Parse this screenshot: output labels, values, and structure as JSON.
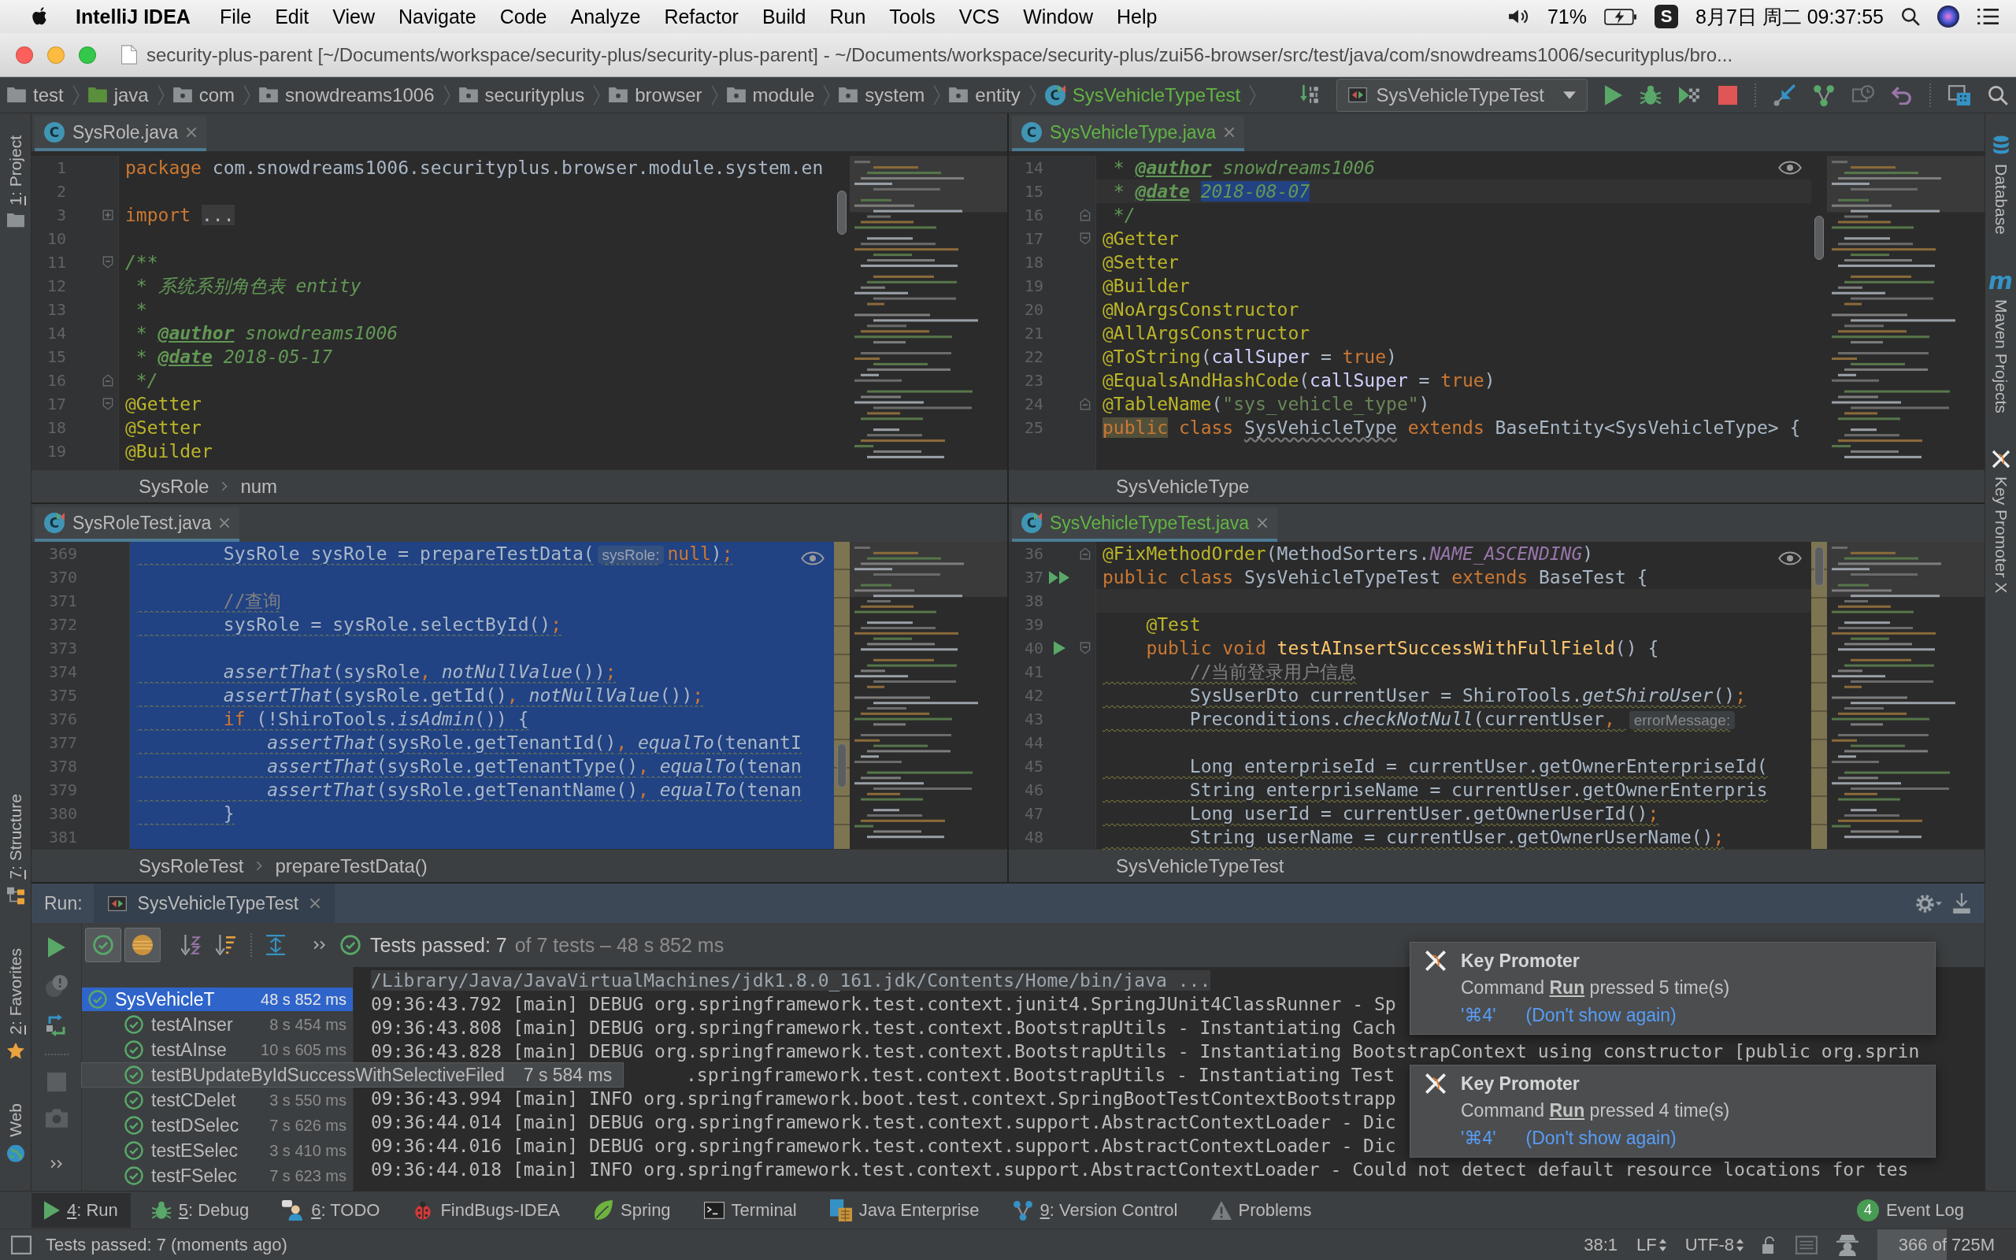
{
  "menubar": {
    "app": "IntelliJ IDEA",
    "menus": [
      "File",
      "Edit",
      "View",
      "Navigate",
      "Code",
      "Analyze",
      "Refactor",
      "Build",
      "Run",
      "Tools",
      "VCS",
      "Window",
      "Help"
    ],
    "battery": "71%",
    "input_method": "S",
    "clock": "8月7日 周二 09:37:55"
  },
  "window": {
    "title": "security-plus-parent [~/Documents/workspace/security-plus/security-plus-parent] - ~/Documents/workspace/security-plus/zui56-browser/src/test/java/com/snowdreams1006/securityplus/bro..."
  },
  "navbar": {
    "crumbs": [
      {
        "label": "test",
        "kind": "folder",
        "new_file": false
      },
      {
        "label": "java",
        "kind": "source-folder",
        "new_file": false
      },
      {
        "label": "com",
        "kind": "package",
        "new_file": false
      },
      {
        "label": "snowdreams1006",
        "kind": "package",
        "new_file": false
      },
      {
        "label": "securityplus",
        "kind": "package",
        "new_file": false
      },
      {
        "label": "browser",
        "kind": "package",
        "new_file": false
      },
      {
        "label": "module",
        "kind": "package",
        "new_file": false
      },
      {
        "label": "system",
        "kind": "package",
        "new_file": false
      },
      {
        "label": "entity",
        "kind": "package",
        "new_file": false
      },
      {
        "label": "SysVehicleTypeTest",
        "kind": "test-class",
        "glyph": "C",
        "new_file": true
      }
    ],
    "run_config": "SysVehicleTypeTest"
  },
  "left_strip": {
    "top": [
      {
        "mnemonic": "1",
        "label": ": Project",
        "kind": "project"
      }
    ],
    "bottom": [
      {
        "mnemonic": "7",
        "label": ": Structure",
        "kind": "structure"
      },
      {
        "mnemonic": "2",
        "label": ": Favorites",
        "kind": "favorites"
      },
      {
        "label": "Web",
        "kind": "web"
      }
    ]
  },
  "right_strip": [
    {
      "label": "Database",
      "kind": "database"
    },
    {
      "label": "Maven Projects",
      "kind": "maven",
      "glyph": "m"
    },
    {
      "label": "Key Promoter X",
      "kind": "promoter"
    }
  ],
  "editors": [
    {
      "tab": {
        "label": "SysRole.java",
        "glyph": "C",
        "kind": "class",
        "new_file": false,
        "selected": true
      },
      "reader_mode": false,
      "lines": [
        {
          "number": "1",
          "tokens": [
            {
              "kind": "keyword",
              "text": "package"
            },
            {
              "kind": "plain",
              "text": " com.snowdreams1006.securityplus.browser.module.system.en"
            }
          ]
        },
        {
          "number": "2"
        },
        {
          "number": "3",
          "collapsed": true,
          "tokens": [
            {
              "kind": "keyword",
              "text": "import"
            },
            {
              "kind": "folded",
              "text": " ..."
            }
          ]
        },
        {
          "number": "10"
        },
        {
          "number": "11",
          "fold_start": true,
          "tokens": [
            {
              "kind": "doc",
              "text": "/**"
            }
          ]
        },
        {
          "number": "12",
          "tokens": [
            {
              "kind": "doc",
              "text": " * 系统系别角色表 entity"
            }
          ]
        },
        {
          "number": "13",
          "tokens": [
            {
              "kind": "doc",
              "text": " *"
            }
          ]
        },
        {
          "number": "14",
          "tokens": [
            {
              "kind": "doc",
              "text": " * "
            },
            {
              "kind": "doctag",
              "text": "@author"
            },
            {
              "kind": "doc",
              "text": " snowdreams1006"
            }
          ]
        },
        {
          "number": "15",
          "tokens": [
            {
              "kind": "doc",
              "text": " * "
            },
            {
              "kind": "doctag",
              "text": "@date"
            },
            {
              "kind": "doc",
              "text": " 2018-05-17"
            }
          ]
        },
        {
          "number": "16",
          "fold_end": true,
          "tokens": [
            {
              "kind": "doc",
              "text": " */"
            }
          ]
        },
        {
          "number": "17",
          "fold_start": true,
          "tokens": [
            {
              "kind": "annotation",
              "text": "@Getter"
            }
          ]
        },
        {
          "number": "18",
          "tokens": [
            {
              "kind": "annotation",
              "text": "@Setter"
            }
          ]
        },
        {
          "number": "19",
          "tokens": [
            {
              "kind": "annotation",
              "text": "@Builder"
            }
          ]
        }
      ],
      "footer": [
        "SysRole",
        "num"
      ]
    },
    {
      "tab": {
        "label": "SysVehicleType.java",
        "glyph": "C",
        "kind": "class",
        "new_file": true,
        "selected": true
      },
      "reader_mode": true,
      "lines": [
        {
          "number": "14",
          "tokens": [
            {
              "kind": "doc",
              "text": " * "
            },
            {
              "kind": "doctag",
              "text": "@author"
            },
            {
              "kind": "doc",
              "text": " snowdreams1006"
            }
          ]
        },
        {
          "number": "15",
          "current": true,
          "tokens": [
            {
              "kind": "doc",
              "text": " * "
            },
            {
              "kind": "doctag",
              "text": "@date"
            },
            {
              "kind": "selected",
              "text": " 2018-08-07"
            }
          ]
        },
        {
          "number": "16",
          "fold_end": true,
          "tokens": [
            {
              "kind": "doc",
              "text": " */"
            }
          ]
        },
        {
          "number": "17",
          "fold_start": true,
          "tokens": [
            {
              "kind": "annotation",
              "text": "@Getter"
            }
          ]
        },
        {
          "number": "18",
          "tokens": [
            {
              "kind": "annotation",
              "text": "@Setter"
            }
          ]
        },
        {
          "number": "19",
          "tokens": [
            {
              "kind": "annotation",
              "text": "@Builder"
            }
          ]
        },
        {
          "number": "20",
          "tokens": [
            {
              "kind": "annotation",
              "text": "@NoArgsConstructor"
            }
          ]
        },
        {
          "number": "21",
          "tokens": [
            {
              "kind": "annotation",
              "text": "@AllArgsConstructor"
            }
          ]
        },
        {
          "number": "22",
          "tokens": [
            {
              "kind": "annotation",
              "text": "@ToString"
            },
            {
              "kind": "plain",
              "text": "("
            },
            {
              "kind": "param",
              "text": "callSuper"
            },
            {
              "kind": "plain",
              "text": " = "
            },
            {
              "kind": "keyword",
              "text": "true"
            },
            {
              "kind": "plain",
              "text": ")"
            }
          ]
        },
        {
          "number": "23",
          "tokens": [
            {
              "kind": "annotation",
              "text": "@EqualsAndHashCode"
            },
            {
              "kind": "plain",
              "text": "("
            },
            {
              "kind": "param",
              "text": "callSuper"
            },
            {
              "kind": "plain",
              "text": " = "
            },
            {
              "kind": "keyword",
              "text": "true"
            },
            {
              "kind": "plain",
              "text": ")"
            }
          ]
        },
        {
          "number": "24",
          "fold_end": true,
          "tokens": [
            {
              "kind": "annotation",
              "text": "@TableName"
            },
            {
              "kind": "plain",
              "text": "("
            },
            {
              "kind": "string",
              "text": "\"sys_vehicle_type\""
            },
            {
              "kind": "plain",
              "text": ")"
            }
          ]
        },
        {
          "number": "25",
          "tokens": [
            {
              "kind": "usage",
              "text": "public"
            },
            {
              "kind": "keyword",
              "text": " class"
            },
            {
              "kind": "warn",
              "text": " SysVehicleType"
            },
            {
              "kind": "keyword",
              "text": " extends"
            },
            {
              "kind": "plain",
              "text": " BaseEntity<SysVehicleType> {"
            }
          ]
        }
      ],
      "footer": [
        "SysVehicleType"
      ]
    },
    {
      "tab": {
        "label": "SysRoleTest.java",
        "glyph": "C",
        "kind": "test-class",
        "new_file": false,
        "selected": true
      },
      "reader_mode": true,
      "lines": [
        {
          "number": "369",
          "selected": true,
          "warning": true,
          "tokens": [
            {
              "kind": "plain",
              "text": "        SysRole sysRole = prepareTestData("
            },
            {
              "kind": "hint",
              "text": "sysRole:"
            },
            {
              "kind": "keyword",
              "text": "null"
            },
            {
              "kind": "plain",
              "text": ")"
            },
            {
              "kind": "keyword",
              "text": ";"
            }
          ]
        },
        {
          "number": "370",
          "selected": true
        },
        {
          "number": "371",
          "selected": true,
          "warning": true,
          "tokens": [
            {
              "kind": "comment",
              "text": "        //查询"
            }
          ]
        },
        {
          "number": "372",
          "selected": true,
          "warning": true,
          "tokens": [
            {
              "kind": "plain",
              "text": "        sysRole = sysRole.selectById()"
            },
            {
              "kind": "keyword",
              "text": ";"
            }
          ]
        },
        {
          "number": "373",
          "selected": true
        },
        {
          "number": "374",
          "selected": true,
          "warning": true,
          "tokens": [
            {
              "kind": "static",
              "text": "        assertThat"
            },
            {
              "kind": "plain",
              "text": "(sysRole"
            },
            {
              "kind": "keyword",
              "text": ","
            },
            {
              "kind": "static",
              "text": " notNullValue"
            },
            {
              "kind": "plain",
              "text": "())"
            },
            {
              "kind": "keyword",
              "text": ";"
            }
          ]
        },
        {
          "number": "375",
          "selected": true,
          "warning": true,
          "tokens": [
            {
              "kind": "static",
              "text": "        assertThat"
            },
            {
              "kind": "plain",
              "text": "(sysRole.getId()"
            },
            {
              "kind": "keyword",
              "text": ","
            },
            {
              "kind": "static",
              "text": " notNullValue"
            },
            {
              "kind": "plain",
              "text": "())"
            },
            {
              "kind": "keyword",
              "text": ";"
            }
          ]
        },
        {
          "number": "376",
          "selected": true,
          "warning": true,
          "tokens": [
            {
              "kind": "keyword",
              "text": "        if"
            },
            {
              "kind": "plain",
              "text": " (!ShiroTools."
            },
            {
              "kind": "static",
              "text": "isAdmin"
            },
            {
              "kind": "plain",
              "text": "()) {"
            }
          ]
        },
        {
          "number": "377",
          "selected": true,
          "warning": true,
          "tokens": [
            {
              "kind": "static",
              "text": "            assertThat"
            },
            {
              "kind": "plain",
              "text": "(sysRole.getTenantId()"
            },
            {
              "kind": "keyword",
              "text": ","
            },
            {
              "kind": "static",
              "text": " equalTo"
            },
            {
              "kind": "plain",
              "text": "(tenantI"
            }
          ]
        },
        {
          "number": "378",
          "selected": true,
          "warning": true,
          "tokens": [
            {
              "kind": "static",
              "text": "            assertThat"
            },
            {
              "kind": "plain",
              "text": "(sysRole.getTenantType()"
            },
            {
              "kind": "keyword",
              "text": ","
            },
            {
              "kind": "static",
              "text": " equalTo"
            },
            {
              "kind": "plain",
              "text": "(tenan"
            }
          ]
        },
        {
          "number": "379",
          "selected": true,
          "warning": true,
          "tokens": [
            {
              "kind": "static",
              "text": "            assertThat"
            },
            {
              "kind": "plain",
              "text": "(sysRole.getTenantName()"
            },
            {
              "kind": "keyword",
              "text": ","
            },
            {
              "kind": "static",
              "text": " equalTo"
            },
            {
              "kind": "plain",
              "text": "(tenan"
            }
          ]
        },
        {
          "number": "380",
          "selected": true,
          "warning": true,
          "tokens": [
            {
              "kind": "plain",
              "text": "        }"
            }
          ]
        },
        {
          "number": "381",
          "selected": true
        }
      ],
      "footer": [
        "SysRoleTest",
        "prepareTestData()"
      ]
    },
    {
      "tab": {
        "label": "SysVehicleTypeTest.java",
        "glyph": "C",
        "kind": "test-class",
        "new_file": true,
        "selected": true
      },
      "reader_mode": true,
      "lines": [
        {
          "number": "36",
          "fold_end": true,
          "tokens": [
            {
              "kind": "annotation",
              "text": "@FixMethodOrder"
            },
            {
              "kind": "plain",
              "text": "(MethodSorters."
            },
            {
              "kind": "constant",
              "text": "NAME_ASCENDING"
            },
            {
              "kind": "plain",
              "text": ")"
            }
          ]
        },
        {
          "number": "37",
          "run_class": true,
          "tokens": [
            {
              "kind": "keyword",
              "text": "public"
            },
            {
              "kind": "keyword",
              "text": " class"
            },
            {
              "kind": "plain",
              "text": " SysVehicleTypeTest"
            },
            {
              "kind": "keyword",
              "text": " extends"
            },
            {
              "kind": "plain",
              "text": " BaseTest {"
            }
          ]
        },
        {
          "number": "38",
          "current": true
        },
        {
          "number": "39",
          "tokens": [
            {
              "kind": "annotation",
              "text": "    @Test"
            }
          ]
        },
        {
          "number": "40",
          "run_test": true,
          "fold_start": true,
          "tokens": [
            {
              "kind": "keyword",
              "text": "    public"
            },
            {
              "kind": "keyword",
              "text": " void"
            },
            {
              "kind": "method",
              "text": " testAInsertSuccessWithFullField"
            },
            {
              "kind": "plain",
              "text": "() {"
            }
          ]
        },
        {
          "number": "41",
          "warning": true,
          "tokens": [
            {
              "kind": "comment",
              "text": "        //当前登录用户信息"
            }
          ]
        },
        {
          "number": "42",
          "warning": true,
          "tokens": [
            {
              "kind": "plain",
              "text": "        SysUserDto currentUser = ShiroTools."
            },
            {
              "kind": "static",
              "text": "getShiroUser"
            },
            {
              "kind": "plain",
              "text": "()"
            },
            {
              "kind": "keyword",
              "text": ";"
            }
          ]
        },
        {
          "number": "43",
          "warning": true,
          "tokens": [
            {
              "kind": "plain",
              "text": "        Preconditions."
            },
            {
              "kind": "static",
              "text": "checkNotNull"
            },
            {
              "kind": "plain",
              "text": "(currentUser"
            },
            {
              "kind": "keyword",
              "text": ","
            },
            {
              "kind": "hint",
              "text": " errorMessage:"
            }
          ]
        },
        {
          "number": "44"
        },
        {
          "number": "45",
          "warning": true,
          "tokens": [
            {
              "kind": "plain",
              "text": "        Long enterpriseId = currentUser.getOwnerEnterpriseId("
            }
          ]
        },
        {
          "number": "46",
          "warning": true,
          "tokens": [
            {
              "kind": "plain",
              "text": "        String enterpriseName = currentUser.getOwnerEnterpris"
            }
          ]
        },
        {
          "number": "47",
          "warning": true,
          "tokens": [
            {
              "kind": "plain",
              "text": "        Long userId = currentUser.getOwnerUserId()"
            },
            {
              "kind": "keyword",
              "text": ";"
            }
          ]
        },
        {
          "number": "48",
          "warning": true,
          "tokens": [
            {
              "kind": "plain",
              "text": "        String userName = currentUser.getOwnerUserName()"
            },
            {
              "kind": "keyword",
              "text": ";"
            }
          ]
        }
      ],
      "footer": [
        "SysVehicleTypeTest"
      ]
    }
  ],
  "run": {
    "title": "Run:",
    "tab": "SysVehicleTypeTest",
    "filters": [
      {
        "kind": "passed",
        "on": true
      },
      {
        "kind": "ignored",
        "on": true
      }
    ],
    "summary": {
      "count": "Tests passed: 7",
      "detail": "of 7 tests – 48 s 852 ms"
    },
    "tree": {
      "name": "SysVehicleT",
      "time": "48 s 852 ms",
      "passed": true,
      "selected": true,
      "children": [
        {
          "name": "testAInser",
          "time": "8 s 454 ms",
          "passed": true,
          "selected": false,
          "hovered": false
        },
        {
          "name": "testAInse",
          "time": "10 s 605 ms",
          "passed": true,
          "selected": false,
          "hovered": false
        },
        {
          "name": "testBUpdateByIdSuccessWithSelectiveFiled",
          "time": "7 s 584 ms",
          "passed": true,
          "selected": false,
          "hovered": true
        },
        {
          "name": "testCDelet",
          "time": "3 s 550 ms",
          "passed": true,
          "selected": false,
          "hovered": false
        },
        {
          "name": "testDSelec",
          "time": "7 s 626 ms",
          "passed": true,
          "selected": false,
          "hovered": false
        },
        {
          "name": "testESelec",
          "time": "3 s 410 ms",
          "passed": true,
          "selected": false,
          "hovered": false
        },
        {
          "name": "testFSelec",
          "time": "7 s 623 ms",
          "passed": true,
          "selected": false,
          "hovered": false
        }
      ]
    },
    "console": [
      {
        "kind": "command",
        "text": "/Library/Java/JavaVirtualMachines/jdk1.8.0_161.jdk/Contents/Home/bin/java ..."
      },
      {
        "kind": "log",
        "text": "09:36:43.792 [main] DEBUG org.springframework.test.context.junit4.SpringJUnit4ClassRunner - Sp"
      },
      {
        "kind": "log",
        "text": "09:36:43.808 [main] DEBUG org.springframework.test.context.BootstrapUtils - Instantiating Cach"
      },
      {
        "kind": "log",
        "text": "09:36:43.828 [main] DEBUG org.springframework.test.context.BootstrapUtils - Instantiating BootstrapContext using constructor [public org.sprin"
      },
      {
        "kind": "covered",
        "text": ".springframework.test.context.BootstrapUtils - Instantiating Test"
      },
      {
        "kind": "log",
        "text": "09:36:43.994 [main] INFO org.springframework.boot.test.context.SpringBootTestContextBootstrapp"
      },
      {
        "kind": "log",
        "text": "09:36:44.014 [main] DEBUG org.springframework.test.context.support.AbstractContextLoader - Dic"
      },
      {
        "kind": "log",
        "text": "09:36:44.016 [main] DEBUG org.springframework.test.context.support.AbstractContextLoader - Dic"
      },
      {
        "kind": "log",
        "text": "09:36:44.018 [main] INFO org.springframework.test.context.support.AbstractContextLoader - Could not detect default resource locations for tes"
      }
    ],
    "notifications": [
      {
        "title": "Key Promoter",
        "message": "Command **Run** pressed 5 time(s)",
        "shortcut": "'⌘4'",
        "dismiss": "(Don't show again)"
      },
      {
        "title": "Key Promoter",
        "message": "Command **Run** pressed 4 time(s)",
        "shortcut": "'⌘4'",
        "dismiss": "(Don't show again)"
      }
    ]
  },
  "tool_windows": {
    "items": [
      {
        "mnemonic": "4",
        "label": ": Run",
        "kind": "run",
        "selected": true
      },
      {
        "mnemonic": "5",
        "label": ": Debug",
        "kind": "debug",
        "selected": false
      },
      {
        "mnemonic": "6",
        "label": ": TODO",
        "kind": "todo",
        "selected": false
      },
      {
        "label": "FindBugs-IDEA",
        "kind": "findbugs",
        "selected": false
      },
      {
        "label": "Spring",
        "kind": "spring",
        "selected": false
      },
      {
        "label": "Terminal",
        "kind": "terminal",
        "selected": false
      },
      {
        "label": "Java Enterprise",
        "kind": "enterprise",
        "selected": false
      },
      {
        "mnemonic": "9",
        "label": ": Version Control",
        "kind": "vcs",
        "selected": false
      },
      {
        "label": "Problems",
        "kind": "problems",
        "selected": false
      }
    ],
    "event_log": {
      "count": "4",
      "label": "Event Log"
    }
  },
  "status_bar": {
    "message": "Tests passed: 7 (moments ago)",
    "position": "38:1",
    "line_separator": "LF",
    "encoding": "UTF-8",
    "memory": {
      "text": "366 of 725M",
      "level": 0.5
    }
  }
}
